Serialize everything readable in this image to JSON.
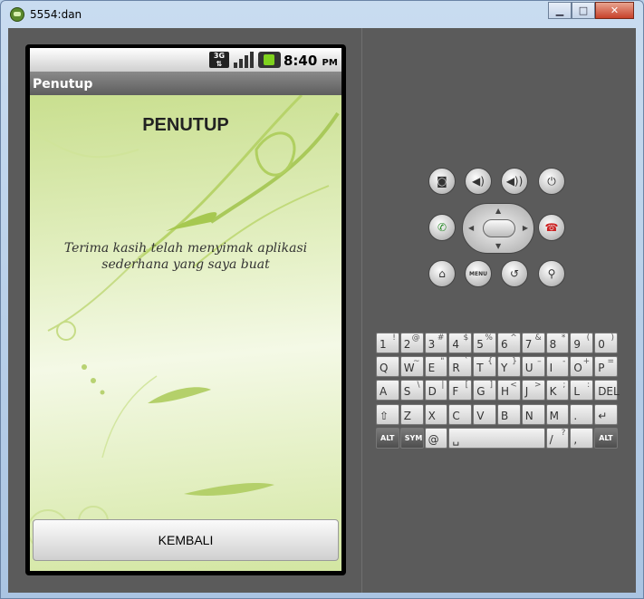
{
  "window": {
    "title": "5554:dan",
    "min_icon": "minimize-icon",
    "max_icon": "maximize-icon",
    "close_icon": "close-icon"
  },
  "statusbar": {
    "network": "3G",
    "time": "8:40",
    "ampm": "PM"
  },
  "app": {
    "title": "Penutup",
    "heading": "PENUTUP",
    "message_line1": "Terima kasih telah menyimak aplikasi",
    "message_line2": "sederhana yang saya buat",
    "button": "KEMBALI"
  },
  "controls": {
    "menu_label": "MENU"
  },
  "keyboard": {
    "row1": [
      [
        "1",
        "!"
      ],
      [
        "2",
        "@"
      ],
      [
        "3",
        "#"
      ],
      [
        "4",
        "$"
      ],
      [
        "5",
        "%"
      ],
      [
        "6",
        "^"
      ],
      [
        "7",
        "&"
      ],
      [
        "8",
        "*"
      ],
      [
        "9",
        "("
      ],
      [
        "0",
        ")"
      ]
    ],
    "row2": [
      [
        "Q",
        ""
      ],
      [
        "W",
        "~"
      ],
      [
        "E",
        "\""
      ],
      [
        "R",
        "`"
      ],
      [
        "T",
        "{"
      ],
      [
        "Y",
        "}"
      ],
      [
        "U",
        "–"
      ],
      [
        "I",
        "-"
      ],
      [
        "O",
        "+"
      ],
      [
        "P",
        "="
      ]
    ],
    "row3": [
      [
        "A",
        ""
      ],
      [
        "S",
        "\\"
      ],
      [
        "D",
        "|"
      ],
      [
        "F",
        "["
      ],
      [
        "G",
        "]"
      ],
      [
        "H",
        "<"
      ],
      [
        "J",
        ">"
      ],
      [
        "K",
        ";"
      ],
      [
        "L",
        ":"
      ],
      [
        "DEL",
        ""
      ]
    ],
    "row4": [
      [
        "⇧",
        ""
      ],
      [
        "Z",
        ""
      ],
      [
        "X",
        ""
      ],
      [
        "C",
        ""
      ],
      [
        "V",
        ""
      ],
      [
        "B",
        ""
      ],
      [
        "N",
        ""
      ],
      [
        "M",
        ""
      ],
      [
        ".",
        ""
      ],
      [
        "↵",
        ""
      ]
    ],
    "row5": {
      "alt_left": "ALT",
      "sym": "SYM",
      "at": "@",
      "space": "␣",
      "slash": "/",
      "question": "?",
      "comma": ",",
      "alt_right": "ALT"
    }
  }
}
